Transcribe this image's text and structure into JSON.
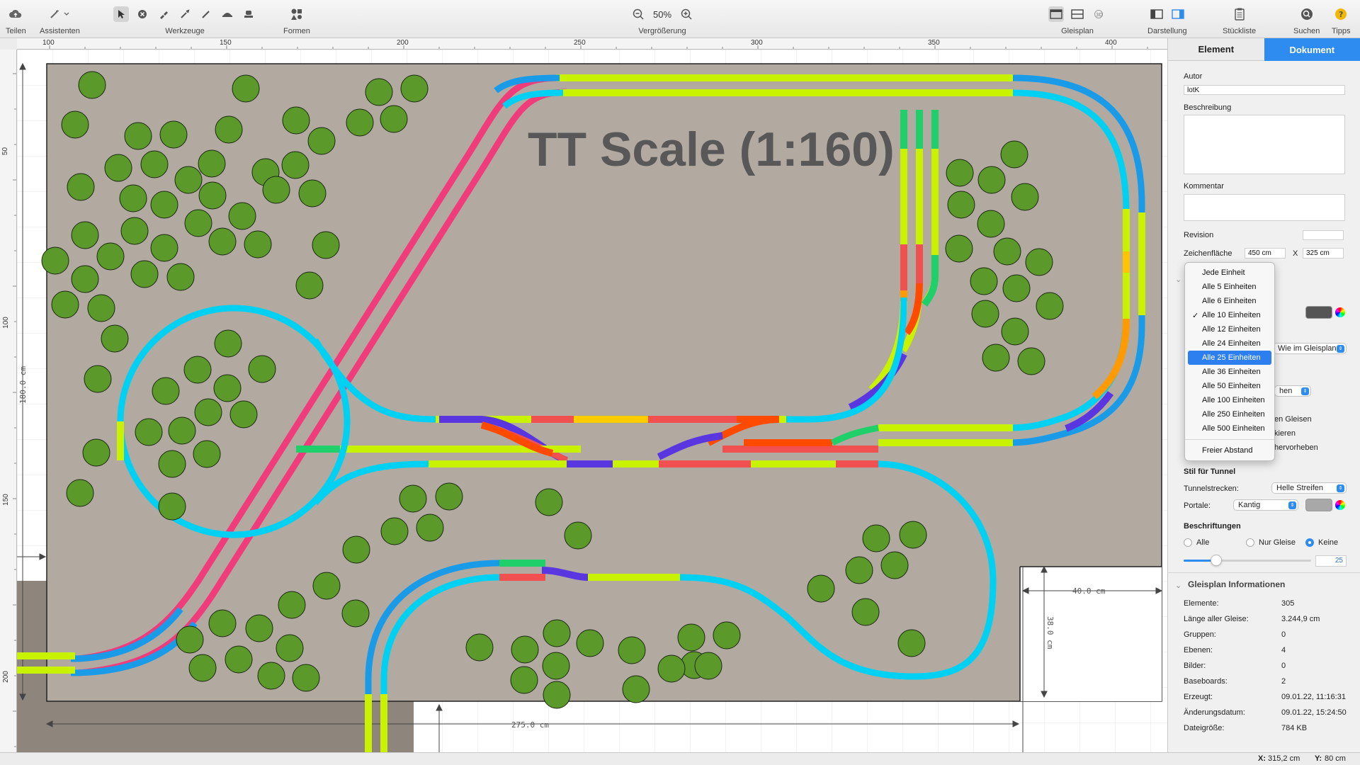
{
  "toolbar": {
    "share_label": "Teilen",
    "assistants_label": "Assistenten",
    "tools_label": "Werkzeuge",
    "shapes_label": "Formen",
    "zoom_label": "Vergrößerung",
    "zoom_value": "50%",
    "trackplan_label": "Gleisplan",
    "display_label": "Darstellung",
    "partslist_label": "Stückliste",
    "search_label": "Suchen",
    "tips_label": "Tipps"
  },
  "rulers": {
    "top": [
      "100",
      "150",
      "200",
      "250",
      "300",
      "350",
      "400"
    ],
    "left": [
      "50",
      "100",
      "150",
      "200"
    ]
  },
  "canvas": {
    "title": "TT Scale (1:160)",
    "dim_height": "180.0 cm",
    "dim_width": "275.0 cm",
    "dim_ext_width": "40.0 cm",
    "dim_ext_height": "38.0 cm"
  },
  "colors": {
    "board": "#b2aaa0",
    "track_cyan": "#00d0f2",
    "track_blue": "#1a9be8",
    "track_lime": "#c9f200",
    "track_pink": "#f03c7a",
    "track_red": "#f05050",
    "track_orange": "#ff7a00",
    "track_violet": "#5a36e0",
    "track_green": "#1fcf6a",
    "tree": "#5b9a2a",
    "accent": "#2e8bf0"
  },
  "sidebar": {
    "tab_element": "Element",
    "tab_document": "Dokument",
    "author_label": "Autor",
    "author_value": "lotK",
    "description_label": "Beschreibung",
    "comment_label": "Kommentar",
    "revision_label": "Revision",
    "drawing_area_label": "Zeichenfläche",
    "drawing_width": "450 cm",
    "drawing_x": "X",
    "drawing_height": "325 cm",
    "popup_as_in_plan": "Wie im Gleisplan",
    "popup_partial": "hen",
    "partial_1": "en Gleisen",
    "partial_2": "kieren",
    "partial_3": "hervorheben",
    "tunnel_style_label": "Stil für Tunnel",
    "tunnel_tracks_label": "Tunnelstrecken:",
    "tunnel_tracks_value": "Helle Streifen",
    "portals_label": "Portale:",
    "portals_value": "Kantig",
    "labels_heading": "Beschriftungen",
    "radio_all": "Alle",
    "radio_tracks_only": "Nur Gleise",
    "radio_none": "Keine",
    "slider_value": "25",
    "info_heading": "Gleisplan Informationen",
    "info": [
      {
        "k": "Elemente:",
        "v": "305"
      },
      {
        "k": "Länge aller Gleise:",
        "v": "3.244,9 cm"
      },
      {
        "k": "Gruppen:",
        "v": "0"
      },
      {
        "k": "Ebenen:",
        "v": "4"
      },
      {
        "k": "Bilder:",
        "v": "0"
      },
      {
        "k": "Baseboards:",
        "v": "2"
      },
      {
        "k": "Erzeugt:",
        "v": "09.01.22, 11:16:31"
      },
      {
        "k": "Änderungsdatum:",
        "v": "09.01.22, 15:24:50"
      },
      {
        "k": "Dateigröße:",
        "v": "784 KB"
      }
    ]
  },
  "menu": {
    "items": [
      "Jede Einheit",
      "Alle 5 Einheiten",
      "Alle 6 Einheiten",
      "Alle 10 Einheiten",
      "Alle 12 Einheiten",
      "Alle 24 Einheiten",
      "Alle 25 Einheiten",
      "Alle 36 Einheiten",
      "Alle 50 Einheiten",
      "Alle 100 Einheiten",
      "Alle 250 Einheiten",
      "Alle 500 Einheiten"
    ],
    "checked": "Alle 10 Einheiten",
    "highlighted": "Alle 25 Einheiten",
    "free_spacing": "Freier Abstand"
  },
  "status": {
    "x_label": "X:",
    "x_value": "315,2 cm",
    "y_label": "Y:",
    "y_value": "80 cm"
  }
}
